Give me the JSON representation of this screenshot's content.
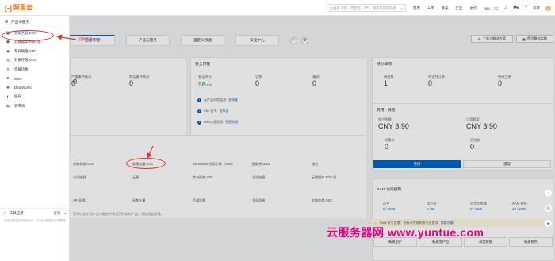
{
  "topbar": {
    "logo_text": "阿里云",
    "search_placeholder": "云搜索 文档、控制台、API、解决方案和资源",
    "nav": [
      "费用",
      "工单",
      "备案",
      "企业",
      "支持",
      "App"
    ],
    "user": "简体"
  },
  "sidebar": {
    "header": "产品与服务",
    "items": [
      {
        "icon": "server-icon",
        "glyph": "▣",
        "label": "云服务器 ECS"
      },
      {
        "icon": "database-icon",
        "glyph": "◉",
        "label": "云数据库 RDS 版"
      },
      {
        "icon": "network-icon",
        "glyph": "◈",
        "label": "专有网络 VPC"
      },
      {
        "icon": "storage-icon",
        "glyph": "◎",
        "label": "对象存储 OSS"
      },
      {
        "icon": "function-icon",
        "glyph": "λ",
        "label": "负载均衡"
      },
      {
        "icon": "cdn-icon",
        "glyph": "✕",
        "label": "CDN"
      },
      {
        "icon": "dataworks-icon",
        "glyph": "❖",
        "label": "DataWorks"
      },
      {
        "icon": "domain-icon",
        "glyph": "◐",
        "label": "域名"
      },
      {
        "icon": "market-icon",
        "glyph": "◍",
        "label": "云市场"
      }
    ],
    "tools": {
      "label": "工具应用",
      "order": "订阅"
    },
    "note": "添加工具应用快速访问，可对应用进行排序管理"
  },
  "annotation": {
    "label": "云服务器 ECS"
  },
  "main": {
    "tabs": [
      "运维管理",
      "产品与服务",
      "自定义视图",
      "安全中心"
    ],
    "add_tab": "+",
    "settings_tab": "⚙",
    "buttons": {
      "tools": "工具与解决方案",
      "home": "首页最佳实践"
    },
    "events": {
      "stats": [
        {
          "label": "",
          "value": "0"
        },
        {
          "label": "严重事件概况",
          "value": "0"
        },
        {
          "label": "警告事件概况",
          "value": "0"
        }
      ]
    },
    "security": {
      "title": "安全预警",
      "score_label": "安全评分",
      "score": "98",
      "score_max": "/100",
      "stats": [
        {
          "label": "告警",
          "value": "0"
        },
        {
          "label": "漏洞",
          "value": "0"
        }
      ],
      "lines": [
        {
          "text": "云产品风险监测",
          "link": "去修复"
        },
        {
          "text": "SSL 证书",
          "link": "去购买"
        },
        {
          "text": "Web入侵检测",
          "link": "免费检测"
        }
      ]
    },
    "todo": {
      "title": "待办事项",
      "stats": [
        {
          "label": "待续费",
          "value": "1"
        },
        {
          "label": "待支付订单",
          "value": "0"
        },
        {
          "label": "待办工单",
          "value": "0"
        }
      ]
    },
    "billing": {
      "title": "费用 · 概览",
      "balance_label": "账户余额",
      "balance": "CNY 3.90",
      "quota_label": "可用额度",
      "quota": "CNY 3.90",
      "coupon_label": "优惠券",
      "coupon": "0",
      "package_label": "资源包",
      "package": "0",
      "recharge": "充值",
      "withdraw": "提现"
    },
    "products": [
      {
        "label": "对象存储 OSS"
      },
      {
        "label": "云服务器 ECS"
      },
      {
        "label": "Serverless 应用引擎（SAE）"
      },
      {
        "label": "云解析 DNS"
      },
      {
        "label": "域名"
      },
      {
        "label": "访问控制"
      },
      {
        "label": "云盾"
      },
      {
        "label": "专有网络 VPC"
      },
      {
        "label": "全站加速"
      },
      {
        "label": "云数据库 RDS 版"
      },
      {
        "label": "API 网关"
      },
      {
        "label": "函数计算"
      },
      {
        "label": "负载均衡"
      },
      {
        "label": "全局加速"
      },
      {
        "label": "对象存储 OSS"
      }
    ],
    "products_note": "您可以在左侧产品与服务中添加已购买的产品，添加到此区域。",
    "ram": {
      "title": "RAM 访问控制",
      "cells": [
        {
          "label": "用户",
          "value": "0 / 1000"
        },
        {
          "label": "用户组",
          "value": "0 / 50"
        },
        {
          "label": "自定义策略",
          "value": "0 / 1500"
        },
        {
          "label": "RAM 角色",
          "value": "19 / 1000"
        }
      ],
      "warning": "RAM 安全设置：您有未完成的安全设置项",
      "warning_link": "查看详情",
      "buttons": [
        "新建用户",
        "新建用户组",
        "添加权限",
        "新建角色"
      ]
    }
  },
  "watermark": "云服务器网 www.yuntue.com"
}
